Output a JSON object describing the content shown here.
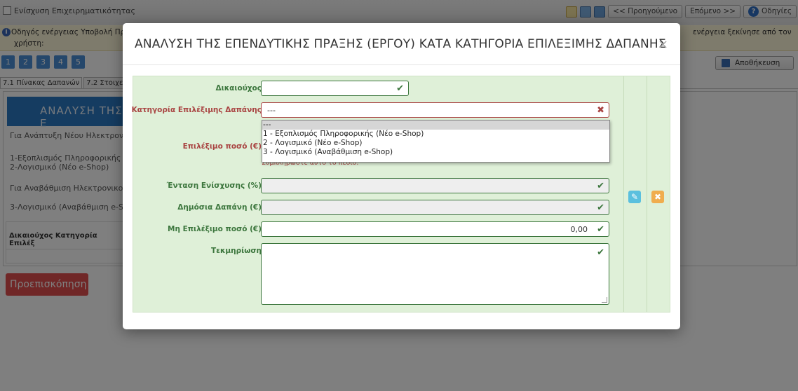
{
  "app": {
    "title": "Ενίσχυση Επιχειρηματικότητας",
    "nav_prev": "<< Προηγούμενο",
    "nav_next": "Επόμενο >>",
    "help": "Οδηγίες",
    "guide_line1": "Οδηγός ενέργειας Υποβολή Πρ",
    "guide_line2": "χρήστη: ",
    "guide_right": "ενέργεια ξεκίνησε από τον",
    "steps": [
      "1",
      "2",
      "3",
      "4",
      "5"
    ],
    "save_label": "Αποθήκευση",
    "tabs": [
      "7.1 Πίνακας Δαπανών",
      "7.2 Στοιχε"
    ],
    "page_heading": "ΑΝΑΛΥΣΗ ΤΗΣ Ε",
    "bg_lines": [
      "Για Ανάπτυξη Νέου Ηλεκτρον",
      "1-Εξοπλισμός Πληροφορικής",
      "2-Λογισμικό (Νέο e-Shop)",
      "Για Αναβάθμιση Ηλεκτρονικο",
      "3-Λογισμικό (Αναβάθμιση e-S"
    ],
    "table_header": "Δικαιούχος   Κατηγορία Επιλέξ",
    "preview_label": "Προεπισκόπηση"
  },
  "modal": {
    "title": "ΑΝΑΛΥΣΗ ΤΗΣ ΕΠΕΝΔΥΤΙΚΗΣ ΠΡΑΞΗΣ (ΕΡΓΟΥ) ΚΑΤΑ ΚΑΤΗΓΟΡΙΑ ΕΠΙΛΕΞΙΜΗΣ ΔΑΠΑΝΗΣ",
    "close": "×",
    "fields": {
      "beneficiary_label": "Δικαιούχος",
      "beneficiary_value": "",
      "category_label": "Κατηγορία Επιλέξιμης Δαπάνης",
      "category_value": "---",
      "eligible_amount_label": "Επιλέξιμο ποσό (€)",
      "eligible_amount_hint": "Συμπληρώστε αυτό το πεδίο.",
      "intensity_label": "Ένταση Ενίσχυσης (%)",
      "public_expense_label": "Δημόσια Δαπάνη (€)",
      "non_eligible_label": "Μη Επιλέξιμο ποσό (€)",
      "non_eligible_value": "0,00",
      "documentation_label": "Τεκμηρίωση"
    },
    "dropdown_options": [
      "---",
      "1 - Εξοπλισμός Πληροφορικής (Νέο e-Shop)",
      "2 - Λογισμικό (Νέο e-Shop)",
      "3 - Λογισμικό (Αναβάθμιση e-Shop)"
    ]
  }
}
